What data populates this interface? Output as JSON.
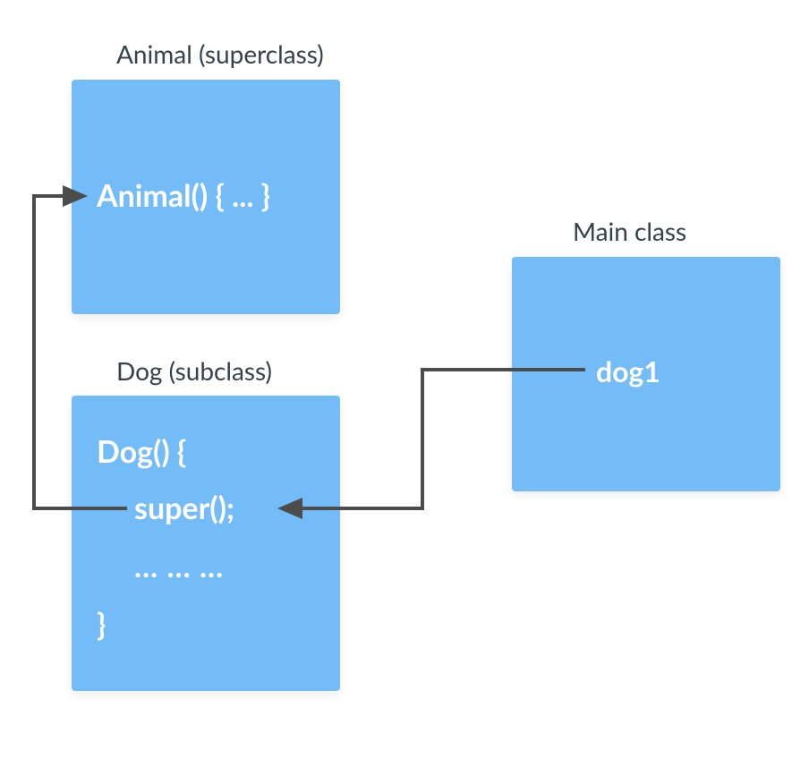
{
  "diagram": {
    "animal": {
      "label": "Animal (superclass)",
      "constructor_signature": "Animal() { ... }"
    },
    "dog": {
      "label": "Dog (subclass)",
      "constructor_open": "Dog() {",
      "super_call": "super();",
      "body_placeholder": "... ... ...",
      "constructor_close": "}"
    },
    "main": {
      "label": "Main class",
      "object_name": "dog1"
    }
  },
  "arrows": [
    {
      "name": "dog1-to-super",
      "description": "Arrow from dog1 in Main class down and left into super(); in Dog subclass"
    },
    {
      "name": "super-to-animal",
      "description": "Arrow from super(); left, up, and into Animal() constructor in Animal superclass"
    }
  ],
  "colors": {
    "box_fill": "#73bcf7",
    "text_dark": "#35424a",
    "text_light": "#ffffff",
    "arrow": "#4c4c4c"
  }
}
